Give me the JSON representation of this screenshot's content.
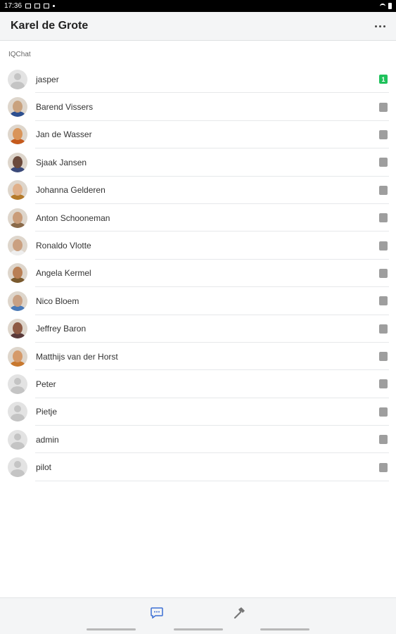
{
  "status_bar": {
    "time": "17:36"
  },
  "header": {
    "title": "Karel de Grote",
    "more_icon": "more-horizontal-icon"
  },
  "section": {
    "label": "IQChat"
  },
  "contacts": [
    {
      "name": "jasper",
      "avatar": "default",
      "badge": "1",
      "badge_color": "#1fc15b"
    },
    {
      "name": "Barend Vissers",
      "avatar": "photo",
      "skin": "#c9a27e",
      "shirt": "#2d4f8f"
    },
    {
      "name": "Jan de Wasser",
      "avatar": "photo",
      "skin": "#d9955a",
      "shirt": "#c55a1c"
    },
    {
      "name": "Sjaak Jansen",
      "avatar": "photo",
      "skin": "#6b4a3c",
      "shirt": "#3b4a7a"
    },
    {
      "name": "Johanna Gelderen",
      "avatar": "photo",
      "skin": "#e0b08a",
      "shirt": "#b47a2a"
    },
    {
      "name": "Anton Schooneman",
      "avatar": "photo",
      "skin": "#c99c79",
      "shirt": "#8a6a4a"
    },
    {
      "name": "Ronaldo Vlotte",
      "avatar": "photo",
      "skin": "#caa080",
      "shirt": "#eeeeee"
    },
    {
      "name": "Angela Kermel",
      "avatar": "photo",
      "skin": "#b97f55",
      "shirt": "#7a5a2e"
    },
    {
      "name": "Nico Bloem",
      "avatar": "photo",
      "skin": "#c8a083",
      "shirt": "#4a7ab8"
    },
    {
      "name": "Jeffrey Baron",
      "avatar": "photo",
      "skin": "#8e5a44",
      "shirt": "#5a3a3a"
    },
    {
      "name": "Matthijs van der Horst",
      "avatar": "photo",
      "skin": "#d59a6a",
      "shirt": "#c8782e"
    },
    {
      "name": "Peter",
      "avatar": "default"
    },
    {
      "name": "Pietje",
      "avatar": "default"
    },
    {
      "name": "admin",
      "avatar": "default"
    },
    {
      "name": "pilot",
      "avatar": "default"
    }
  ],
  "bottom_nav": [
    {
      "icon": "chat-icon",
      "active": true,
      "color": "#3b6fd4"
    },
    {
      "icon": "hammer-icon",
      "active": false,
      "color": "#777777"
    }
  ]
}
